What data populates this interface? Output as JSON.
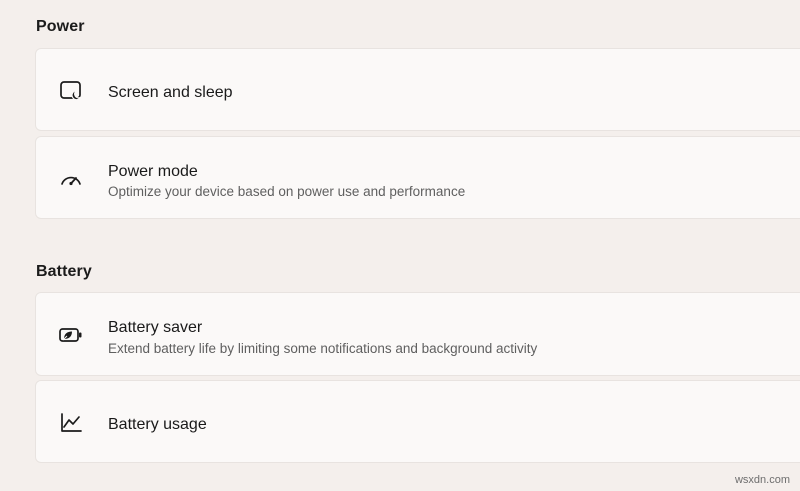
{
  "sections": {
    "power": {
      "heading": "Power",
      "items": [
        {
          "title": "Screen and sleep",
          "subtitle": "",
          "icon": "screen-sleep-icon"
        },
        {
          "title": "Power mode",
          "subtitle": "Optimize your device based on power use and performance",
          "icon": "power-mode-gauge-icon"
        }
      ]
    },
    "battery": {
      "heading": "Battery",
      "items": [
        {
          "title": "Battery saver",
          "subtitle": "Extend battery life by limiting some notifications and background activity",
          "icon": "battery-saver-icon"
        },
        {
          "title": "Battery usage",
          "subtitle": "",
          "icon": "battery-usage-chart-icon"
        }
      ]
    }
  },
  "watermark": "wsxdn.com",
  "colors": {
    "background": "#f4efec",
    "card": "#fbf9f8",
    "card_border": "#e8e3e0",
    "subtitle_text": "#5f5f5f"
  }
}
